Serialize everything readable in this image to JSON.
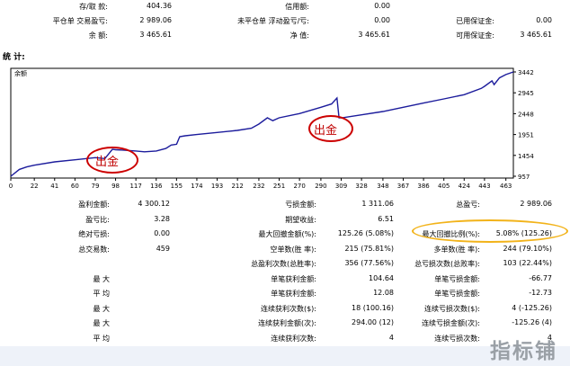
{
  "summary": {
    "rows": [
      {
        "l1": "存/取 款:",
        "v1": "404.36",
        "l2": "信用额:",
        "v2": "0.00",
        "l3": "",
        "v3": ""
      },
      {
        "l1": "平仓单 交易盈亏:",
        "v1": "2 989.06",
        "l2": "未平仓单 浮动盈亏/亏:",
        "v2": "0.00",
        "l3": "已用保证金:",
        "v3": "0.00"
      },
      {
        "l1": "余  额:",
        "v1": "3 465.61",
        "l2": "净  值:",
        "v2": "3 465.61",
        "l3": "可用保证金:",
        "v3": "3 465.61"
      }
    ]
  },
  "section_title": "统 计:",
  "chart_data": {
    "type": "line",
    "legend_label": "余额",
    "x_ticks": [
      0,
      22,
      41,
      60,
      79,
      98,
      117,
      136,
      155,
      174,
      193,
      212,
      232,
      251,
      270,
      290,
      309,
      328,
      348,
      367,
      386,
      405,
      424,
      443,
      463
    ],
    "y_ticks": [
      957,
      1454,
      1951,
      2448,
      2945,
      3442
    ],
    "ylim": [
      957,
      3442
    ],
    "xlim": [
      0,
      470
    ],
    "series": [
      {
        "color": "#1c1c9c",
        "points": [
          [
            0,
            957
          ],
          [
            8,
            1120
          ],
          [
            15,
            1180
          ],
          [
            22,
            1220
          ],
          [
            41,
            1300
          ],
          [
            60,
            1350
          ],
          [
            79,
            1400
          ],
          [
            88,
            1380
          ],
          [
            95,
            1600
          ],
          [
            98,
            1590
          ],
          [
            105,
            1580
          ],
          [
            117,
            1560
          ],
          [
            125,
            1540
          ],
          [
            136,
            1560
          ],
          [
            145,
            1620
          ],
          [
            150,
            1700
          ],
          [
            155,
            1720
          ],
          [
            158,
            1900
          ],
          [
            163,
            1920
          ],
          [
            174,
            1950
          ],
          [
            193,
            2000
          ],
          [
            212,
            2050
          ],
          [
            225,
            2100
          ],
          [
            232,
            2200
          ],
          [
            240,
            2350
          ],
          [
            245,
            2280
          ],
          [
            251,
            2350
          ],
          [
            270,
            2450
          ],
          [
            290,
            2600
          ],
          [
            300,
            2680
          ],
          [
            305,
            2820
          ],
          [
            307,
            2350
          ],
          [
            310,
            2350
          ],
          [
            328,
            2420
          ],
          [
            348,
            2500
          ],
          [
            367,
            2600
          ],
          [
            386,
            2700
          ],
          [
            405,
            2800
          ],
          [
            424,
            2900
          ],
          [
            440,
            3050
          ],
          [
            443,
            3100
          ],
          [
            450,
            3230
          ],
          [
            452,
            3140
          ],
          [
            457,
            3300
          ],
          [
            463,
            3380
          ],
          [
            470,
            3442
          ]
        ]
      }
    ],
    "annotations": [
      "出金",
      "出金"
    ]
  },
  "stats": {
    "rows": [
      {
        "l1": "盈利金额:",
        "v1": "4 300.12",
        "l2": "亏损金额:",
        "v2": "1 311.06",
        "l3": "总盈亏:",
        "v3": "2 989.06"
      },
      {
        "l1": "盈亏比:",
        "v1": "3.28",
        "l2": "期望收益:",
        "v2": "6.51",
        "l3": "",
        "v3": ""
      },
      {
        "l1": "绝对亏损:",
        "v1": "0.00",
        "l2": "最大回撤金额(%):",
        "v2": "125.26 (5.08%)",
        "l3": "最大回撤比例(%):",
        "v3": "5.08% (125.26)"
      },
      {
        "l1": "总交易数:",
        "v1": "459",
        "l2": "空单数(胜 率):",
        "v2": "215 (75.81%)",
        "l3": "多单数(胜 率):",
        "v3": "244 (79.10%)"
      },
      {
        "l1": "",
        "v1": "",
        "l2": "总盈利次数(总胜率):",
        "v2": "356 (77.56%)",
        "l3": "总亏损次数(总败率):",
        "v3": "103 (22.44%)"
      },
      {
        "l1": "最 大",
        "v1": "",
        "l2": "单笔获利金额:",
        "v2": "104.64",
        "l3": "单笔亏损金额:",
        "v3": "-66.77"
      },
      {
        "l1": "平 均",
        "v1": "",
        "l2": "单笔获利金额:",
        "v2": "12.08",
        "l3": "单笔亏损金额:",
        "v3": "-12.73"
      },
      {
        "l1": "最 大",
        "v1": "",
        "l2": "连续获利次数($):",
        "v2": "18 (100.16)",
        "l3": "连续亏损次数($):",
        "v3": "4 (-125.26)"
      },
      {
        "l1": "最 大",
        "v1": "",
        "l2": "连续获利金额(次):",
        "v2": "294.00 (12)",
        "l3": "连续亏损金额(次):",
        "v3": "-125.26 (4)"
      },
      {
        "l1": "平 均",
        "v1": "",
        "l2": "连续获利次数:",
        "v2": "4",
        "l3": "连续亏损次数:",
        "v3": "4"
      }
    ]
  },
  "watermark": "指标铺",
  "colors": {
    "line": "#1c1c9c",
    "annotation_red": "#cc0000",
    "annotation_orange": "#f2b31a"
  }
}
